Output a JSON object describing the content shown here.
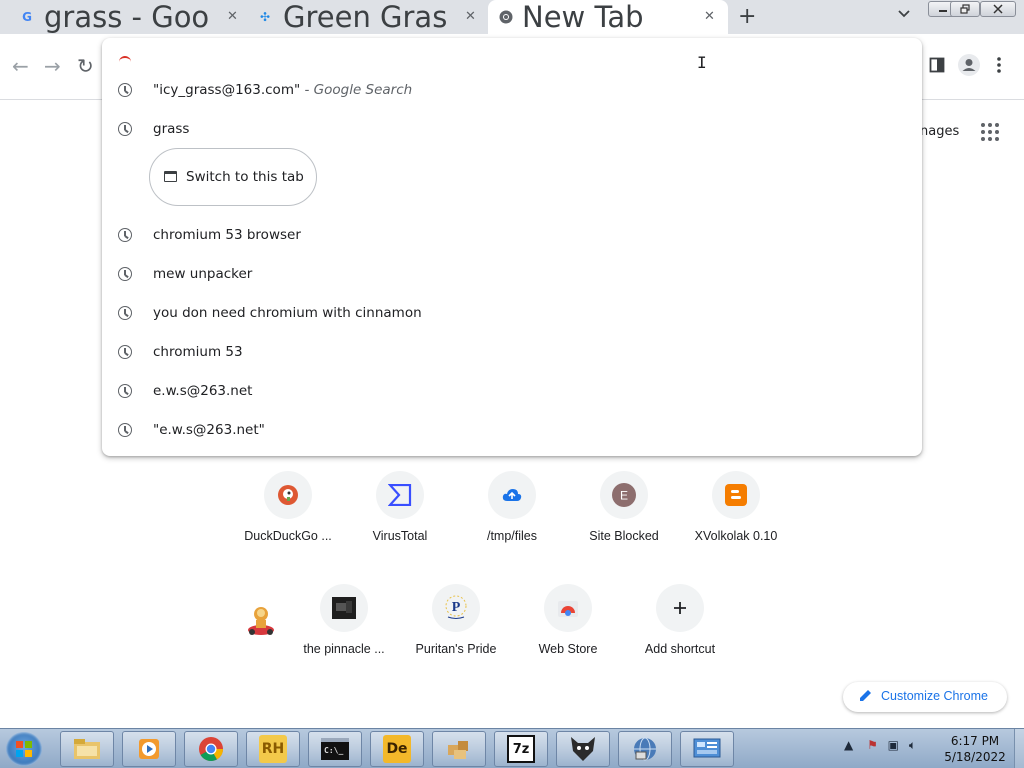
{
  "tabs": [
    {
      "title": "grass - Goo",
      "favicon": "google-g",
      "active": false
    },
    {
      "title": "Green Gras",
      "favicon": "blue-pinwheel",
      "active": false
    },
    {
      "title": "New Tab",
      "favicon": "chrome",
      "active": true
    }
  ],
  "tab_close_glyph": "✕",
  "new_tab_glyph": "+",
  "omnibox": {
    "input_value": "",
    "suggestions": [
      {
        "text": "\"icy_grass@163.com\"",
        "suffix": " - Google Search",
        "icon": "history-clock-icon"
      },
      {
        "text": "grass",
        "suffix": "",
        "icon": "history-clock-icon"
      },
      {
        "text": "chromium 53 browser",
        "suffix": "",
        "icon": "history-clock-icon"
      },
      {
        "text": "mew unpacker",
        "suffix": "",
        "icon": "history-clock-icon"
      },
      {
        "text": "you don need chromium with cinnamon",
        "suffix": "",
        "icon": "history-clock-icon"
      },
      {
        "text": "chromium 53",
        "suffix": "",
        "icon": "history-clock-icon"
      },
      {
        "text": "e.w.s@263.net",
        "suffix": "",
        "icon": "history-clock-icon"
      },
      {
        "text": "\"e.w.s@263.net\"",
        "suffix": "",
        "icon": "history-clock-icon"
      }
    ],
    "switch_tab_label": "Switch to this tab"
  },
  "header_links": {
    "images": "nages"
  },
  "shortcuts_row1": [
    {
      "label": "DuckDuckGo ...",
      "icon": "duckduckgo-icon",
      "color": "#de5833"
    },
    {
      "label": "VirusTotal",
      "icon": "virustotal-icon",
      "color": "#394eff"
    },
    {
      "label": "/tmp/files",
      "icon": "cloud-upload-icon",
      "color": "#1a73e8"
    },
    {
      "label": "Site Blocked",
      "icon": "letter-e-icon",
      "color": "#8d6e6e"
    },
    {
      "label": "XVolkolak 0.10",
      "icon": "blogger-icon",
      "color": "#f57d00"
    }
  ],
  "shortcuts_row2": [
    {
      "label": "the pinnacle ...",
      "icon": "dark-thumbnail-icon",
      "color": "#222222"
    },
    {
      "label": "Puritan's Pride",
      "icon": "puritans-pride-icon",
      "color": "#1b3a8a"
    },
    {
      "label": "Web Store",
      "icon": "chrome-web-store-icon",
      "color": "#ea4335"
    },
    {
      "label": "Add shortcut",
      "icon": "plus-icon",
      "color": "#202124"
    }
  ],
  "customize_label": "Customize Chrome",
  "taskbar": {
    "time": "6:17 PM",
    "date": "5/18/2022",
    "apps": [
      "file-explorer-icon",
      "media-player-icon",
      "chrome-icon",
      "rh-icon",
      "cmd-icon",
      "de-icon",
      "package-icon",
      "7zip-icon",
      "wolf-icon",
      "network-globe-icon",
      "control-panel-icon"
    ]
  },
  "colors": {
    "accent": "#1a73e8",
    "tab_strip": "#dee1e6",
    "taskbar": "#9fb6d2"
  }
}
